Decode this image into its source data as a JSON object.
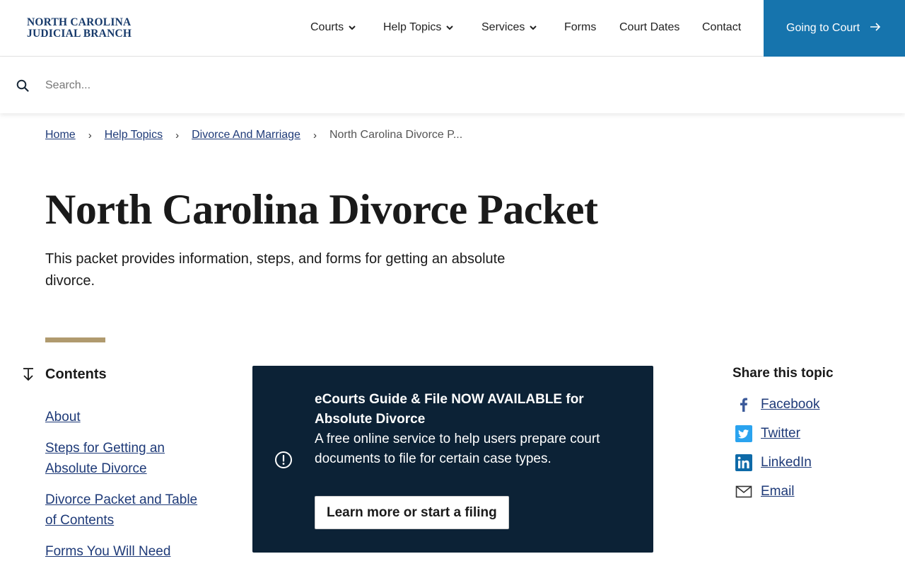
{
  "header": {
    "logo_line1": "NORTH CAROLINA",
    "logo_line2": "JUDICIAL BRANCH",
    "nav": [
      {
        "label": "Courts",
        "has_dropdown": true
      },
      {
        "label": "Help Topics",
        "has_dropdown": true
      },
      {
        "label": "Services",
        "has_dropdown": true
      },
      {
        "label": "Forms",
        "has_dropdown": false
      },
      {
        "label": "Court Dates",
        "has_dropdown": false
      },
      {
        "label": "Contact",
        "has_dropdown": false
      }
    ],
    "cta_label": "Going to Court",
    "brand_color": "#1674ad",
    "logo_color": "#173a6b"
  },
  "search": {
    "placeholder": "Search...",
    "value": ""
  },
  "breadcrumb": {
    "items": [
      "Home",
      "Help Topics",
      "Divorce And Marriage"
    ],
    "current": "North Carolina Divorce P..."
  },
  "page": {
    "title": "North Carolina Divorce Packet",
    "intro": "This packet provides information, steps, and forms for getting an absolute divorce.",
    "accent_color": "#b09a6e"
  },
  "contents": {
    "heading": "Contents",
    "items": [
      "About",
      "Steps for Getting an Absolute Divorce",
      "Divorce Packet and Table of Contents",
      "Forms You Will Need"
    ]
  },
  "alert": {
    "title": "eCourts Guide & File NOW AVAILABLE for Absolute Divorce",
    "body": "A free online service to help users prepare court documents to file for certain case types.",
    "button_label": "Learn more or start a filing",
    "background_color": "#0c2236"
  },
  "share": {
    "heading": "Share this topic",
    "items": [
      {
        "label": "Facebook",
        "icon": "facebook-icon"
      },
      {
        "label": "Twitter",
        "icon": "twitter-icon"
      },
      {
        "label": "LinkedIn",
        "icon": "linkedin-icon"
      },
      {
        "label": "Email",
        "icon": "email-icon"
      }
    ]
  }
}
